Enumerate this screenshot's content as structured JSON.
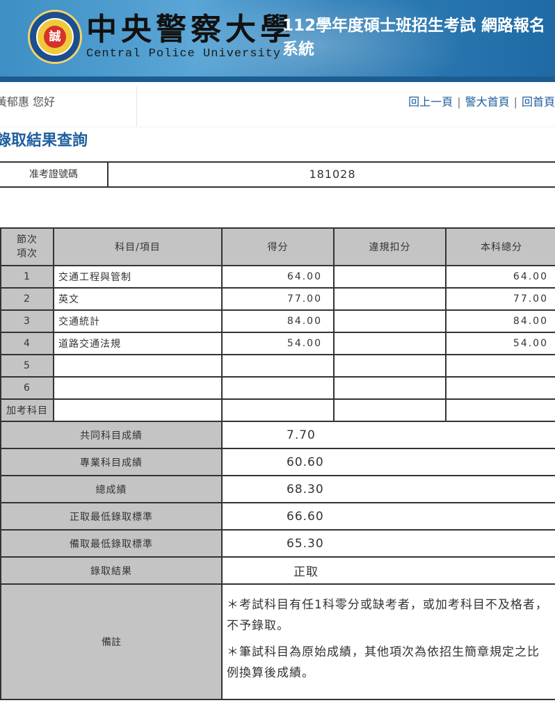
{
  "header": {
    "logo_text": "誠",
    "university_zh": "中央警察大學",
    "university_en": "Central Police University",
    "system_title": "112學年度碩士班招生考試 網路報名系統"
  },
  "nav": {
    "welcome": "黃郁惠 您好",
    "links": [
      "回上一頁",
      "警大首頁",
      "回首頁"
    ],
    "separator": "|"
  },
  "page_title": "錄取結果查詢",
  "exam_id": {
    "label": "准考證號碼",
    "value": "181028"
  },
  "score_table": {
    "headers": {
      "number": "節次項次",
      "subject": "科目/項目",
      "score": "得分",
      "deduction": "違規扣分",
      "total": "本科總分"
    },
    "rows": [
      {
        "no": "1",
        "subject": "交通工程與管制",
        "score": "64.00",
        "deduction": "",
        "total": "64.00"
      },
      {
        "no": "2",
        "subject": "英文",
        "score": "77.00",
        "deduction": "",
        "total": "77.00"
      },
      {
        "no": "3",
        "subject": "交通統計",
        "score": "84.00",
        "deduction": "",
        "total": "84.00"
      },
      {
        "no": "4",
        "subject": "道路交通法規",
        "score": "54.00",
        "deduction": "",
        "total": "54.00"
      },
      {
        "no": "5",
        "subject": "",
        "score": "",
        "deduction": "",
        "total": ""
      },
      {
        "no": "6",
        "subject": "",
        "score": "",
        "deduction": "",
        "total": ""
      },
      {
        "no": "加考科目",
        "subject": "",
        "score": "",
        "deduction": "",
        "total": ""
      }
    ],
    "results": [
      {
        "label": "共同科目成績",
        "value": "7.70"
      },
      {
        "label": "專業科目成績",
        "value": "60.60"
      },
      {
        "label": "總成績",
        "value": "68.30"
      },
      {
        "label": "正取最低錄取標準",
        "value": "66.60"
      },
      {
        "label": "備取最低錄取標準",
        "value": "65.30"
      },
      {
        "label": "錄取結果",
        "value": "正取"
      }
    ],
    "notes_label": "備註",
    "notes": [
      "＊考試科目有任1科零分或缺考者，或加考科目不及格者，不予錄取。",
      "＊筆試科目為原始成績，其他項次為依招生簡章規定之比例換算後成績。"
    ]
  }
}
